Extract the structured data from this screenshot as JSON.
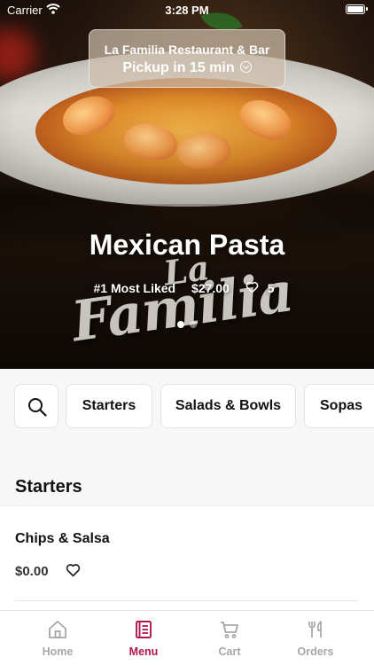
{
  "status_bar": {
    "carrier": "Carrier",
    "time": "3:28 PM"
  },
  "pickup": {
    "restaurant": "La Familia Restaurant & Bar",
    "time_label": "Pickup in 15 min"
  },
  "featured": {
    "title": "Mexican Pasta",
    "badge": "#1 Most Liked",
    "price": "$27.00",
    "likes": "5",
    "slides": 2,
    "active_slide": 1,
    "logo_text_top": "La",
    "logo_text_bottom": "Familia"
  },
  "categories": {
    "search_icon": "search-icon",
    "items": [
      "Starters",
      "Salads & Bowls",
      "Sopas"
    ]
  },
  "section": {
    "title": "Starters"
  },
  "menu_items": [
    {
      "name": "Chips & Salsa",
      "price": "$0.00"
    }
  ],
  "tabs": [
    {
      "label": "Home",
      "icon": "home-icon",
      "active": false
    },
    {
      "label": "Menu",
      "icon": "menu-icon",
      "active": true
    },
    {
      "label": "Cart",
      "icon": "cart-icon",
      "active": false
    },
    {
      "label": "Orders",
      "icon": "utensils-icon",
      "active": false
    }
  ],
  "colors": {
    "accent": "#b0164f",
    "inactive": "#a6a6a6"
  }
}
